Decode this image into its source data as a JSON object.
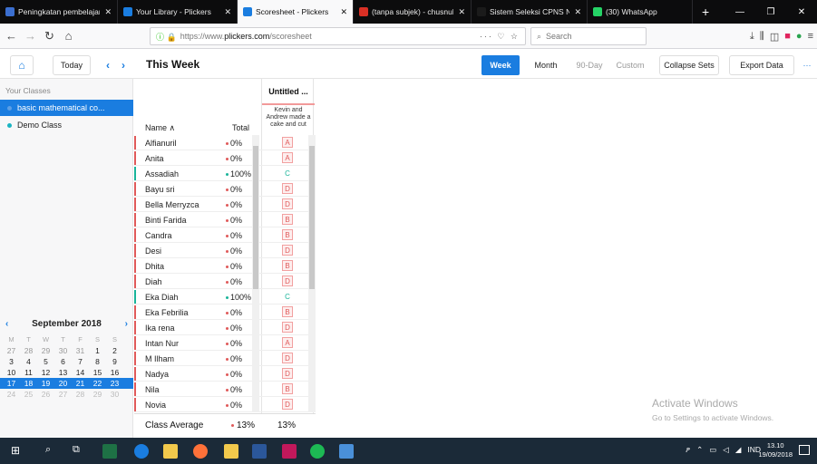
{
  "browser": {
    "tabs": [
      {
        "title": "Peningkatan pembelajar",
        "color": "#3b6fd0"
      },
      {
        "title": "Your Library - Plickers",
        "color": "#1a7de0"
      },
      {
        "title": "Scoresheet - Plickers",
        "color": "#1a7de0"
      },
      {
        "title": "(tanpa subjek) - chusnul",
        "color": "#d93025"
      },
      {
        "title": "Sistem Seleksi CPNS Nasiona",
        "color": "#1b1b1b"
      },
      {
        "title": "(30) WhatsApp",
        "color": "#25d366"
      }
    ],
    "url": {
      "scheme": "https://www.",
      "domain": "plickers.com",
      "path": "/scoresheet"
    },
    "url_more": "···",
    "search_placeholder": "Search"
  },
  "toolbar": {
    "today": "Today",
    "title": "This Week",
    "ranges": [
      "Week",
      "Month",
      "90-Day",
      "Custom"
    ],
    "collapse_sets": "Collapse Sets",
    "export_data": "Export Data",
    "more": "···"
  },
  "sidebar": {
    "header": "Your Classes",
    "classes": [
      "basic mathematical co...",
      "Demo Class"
    ]
  },
  "calendar": {
    "month": "September 2018",
    "weekdays": [
      "M",
      "T",
      "W",
      "T",
      "F",
      "S",
      "S"
    ],
    "weeks": [
      [
        "27",
        "28",
        "29",
        "30",
        "31",
        "1",
        "2"
      ],
      [
        "3",
        "4",
        "5",
        "6",
        "7",
        "8",
        "9"
      ],
      [
        "10",
        "11",
        "12",
        "13",
        "14",
        "15",
        "16"
      ],
      [
        "17",
        "18",
        "19",
        "20",
        "21",
        "22",
        "23"
      ],
      [
        "24",
        "25",
        "26",
        "27",
        "28",
        "29",
        "30"
      ]
    ]
  },
  "table": {
    "name_header": "Name ∧",
    "total_header": "Total",
    "question_title": "Untitled ...",
    "question_text": "Kevin and Andrew made a cake and cut",
    "rows": [
      {
        "name": "Alfianuril",
        "total": "0%",
        "answer": "A",
        "correct": false
      },
      {
        "name": "Anita",
        "total": "0%",
        "answer": "A",
        "correct": false
      },
      {
        "name": "Assadiah",
        "total": "100%",
        "answer": "C",
        "correct": true
      },
      {
        "name": "Bayu sri",
        "total": "0%",
        "answer": "D",
        "correct": false
      },
      {
        "name": "Bella Merryzca",
        "total": "0%",
        "answer": "D",
        "correct": false
      },
      {
        "name": "Binti Farida",
        "total": "0%",
        "answer": "B",
        "correct": false
      },
      {
        "name": "Candra",
        "total": "0%",
        "answer": "B",
        "correct": false
      },
      {
        "name": "Desi",
        "total": "0%",
        "answer": "D",
        "correct": false
      },
      {
        "name": "Dhita",
        "total": "0%",
        "answer": "B",
        "correct": false
      },
      {
        "name": "Diah",
        "total": "0%",
        "answer": "D",
        "correct": false
      },
      {
        "name": "Eka Diah",
        "total": "100%",
        "answer": "C",
        "correct": true
      },
      {
        "name": "Eka Febrilia",
        "total": "0%",
        "answer": "B",
        "correct": false
      },
      {
        "name": "Ika rena",
        "total": "0%",
        "answer": "D",
        "correct": false
      },
      {
        "name": "Intan Nur",
        "total": "0%",
        "answer": "A",
        "correct": false
      },
      {
        "name": "M Ilham",
        "total": "0%",
        "answer": "D",
        "correct": false
      },
      {
        "name": "Nadya",
        "total": "0%",
        "answer": "D",
        "correct": false
      },
      {
        "name": "Nila",
        "total": "0%",
        "answer": "B",
        "correct": false
      },
      {
        "name": "Novia",
        "total": "0%",
        "answer": "D",
        "correct": false
      }
    ],
    "class_average_label": "Class Average",
    "class_average_total": "13%",
    "class_average_question": "13%"
  },
  "windows": {
    "activate_title": "Activate Windows",
    "activate_sub": "Go to Settings to activate Windows.",
    "tray_lang": "IND",
    "time": "13.10",
    "date": "19/09/2018"
  },
  "colors": {
    "accent": "#1a7de0",
    "correct": "#1ab49a",
    "incorrect": "#e05a5a"
  }
}
